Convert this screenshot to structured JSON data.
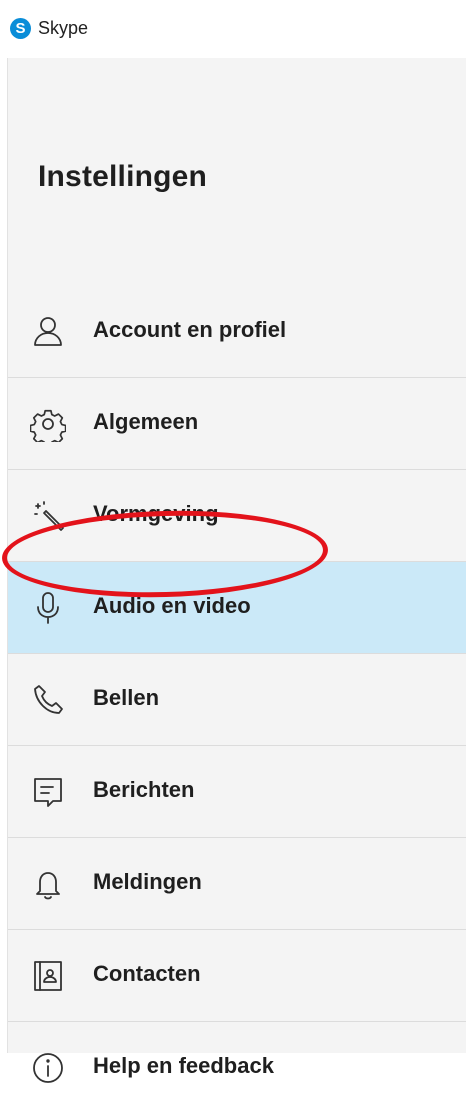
{
  "titlebar": {
    "app_name": "Skype",
    "logo_letter": "S",
    "logo_color": "#0a8dd8"
  },
  "settings": {
    "title": "Instellingen",
    "active_color": "#cbe9f8",
    "items": [
      {
        "label": "Account en profiel",
        "icon": "person-icon"
      },
      {
        "label": "Algemeen",
        "icon": "gear-icon"
      },
      {
        "label": "Vormgeving",
        "icon": "magic-wand-icon"
      },
      {
        "label": "Audio en video",
        "icon": "microphone-icon",
        "selected": true
      },
      {
        "label": "Bellen",
        "icon": "phone-icon"
      },
      {
        "label": "Berichten",
        "icon": "message-icon"
      },
      {
        "label": "Meldingen",
        "icon": "bell-icon"
      },
      {
        "label": "Contacten",
        "icon": "contact-card-icon"
      },
      {
        "label": "Help en feedback",
        "icon": "info-icon"
      }
    ]
  },
  "annotation": {
    "shape": "ellipse",
    "color": "#e3131b"
  }
}
